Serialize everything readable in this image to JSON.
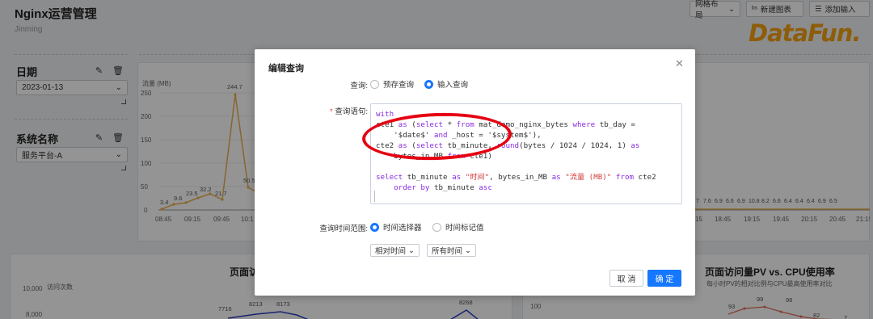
{
  "app": {
    "title": "Nginx运营管理",
    "subtitle": "Jinming"
  },
  "toolbar": {
    "grid_layout": "网格布局",
    "new_chart": "新建图表",
    "add_input": "添加输入",
    "grid_chevron_icon": "chevron-down",
    "new_chart_icon": "bar-chart",
    "add_input_icon": "list"
  },
  "logo": {
    "text": "DataFun."
  },
  "filters": [
    {
      "title": "日期",
      "value": "2023-01-13"
    },
    {
      "title": "系统名称",
      "value": "服务平台-A"
    }
  ],
  "traffic_chart": {
    "ylabel": "流量 (MB)",
    "y_ticks": [
      "250",
      "200",
      "150",
      "100",
      "50",
      "0"
    ],
    "x_ticks": [
      "08:45",
      "09:15",
      "09:45",
      "10:1"
    ],
    "data_labels": [
      "3.4",
      "9.6",
      "23.5",
      "32.2",
      "21.7",
      "244.7",
      "50.5"
    ],
    "right_x_ticks": [
      "15",
      "18:45",
      "19:15",
      "19:45",
      "20:15",
      "20:45",
      "21:15"
    ],
    "right_labels": [
      ".7",
      "7.6",
      "6.9",
      "6.6",
      "6.9",
      "10.8",
      "8.2",
      "6.6",
      "6.4",
      "6.4",
      "6.4",
      "6.9",
      "6.5"
    ],
    "line_color": "#e8b04f"
  },
  "pv_chart": {
    "title": "页面访",
    "ylabel": "访问次数",
    "y_ticks": [
      "10,000",
      "8,000"
    ],
    "data_labels": [
      "7716",
      "8213",
      "8173",
      "8268"
    ],
    "line_color": "#2c3fbf"
  },
  "pv_cpu_chart": {
    "title": "页面访问量PV vs. CPU使用率",
    "subtitle": "每小时PV的相对比例与CPU最高使用率对比",
    "y_tick": "100",
    "data_labels": [
      "93",
      "99",
      "98",
      "82",
      "7"
    ],
    "line_color": "#e36a57"
  },
  "modal": {
    "title": "编辑查询",
    "query_label": "查询:",
    "query_options": [
      "预存查询",
      "输入查询"
    ],
    "query_selected": 1,
    "sql_label": "查询语句:",
    "sql_lines": [
      [
        {
          "t": "with",
          "c": "kw"
        }
      ],
      [
        {
          "t": "cte1 ",
          "c": ""
        },
        {
          "t": "as",
          "c": "kw"
        },
        {
          "t": " (",
          "c": ""
        },
        {
          "t": "select",
          "c": "kw"
        },
        {
          "t": " * ",
          "c": ""
        },
        {
          "t": "from",
          "c": "kw"
        },
        {
          "t": " mat_demo_nginx_bytes ",
          "c": ""
        },
        {
          "t": "where",
          "c": "kw"
        },
        {
          "t": " tb_day =",
          "c": ""
        }
      ],
      [
        {
          "t": "    '$date$' ",
          "c": ""
        },
        {
          "t": "and",
          "c": "kw"
        },
        {
          "t": " _host = '$system$'),",
          "c": ""
        }
      ],
      [
        {
          "t": "cte2 ",
          "c": ""
        },
        {
          "t": "as",
          "c": "kw"
        },
        {
          "t": " (",
          "c": ""
        },
        {
          "t": "select",
          "c": "kw"
        },
        {
          "t": " tb_minute, ",
          "c": ""
        },
        {
          "t": "round",
          "c": "kw"
        },
        {
          "t": "(bytes / 1024 / 1024, 1) ",
          "c": ""
        },
        {
          "t": "as",
          "c": "kw"
        }
      ],
      [
        {
          "t": "    bytes_in_MB ",
          "c": ""
        },
        {
          "t": "from",
          "c": "kw"
        },
        {
          "t": " cte1)",
          "c": ""
        }
      ],
      [
        {
          "t": "",
          "c": ""
        }
      ],
      [
        {
          "t": "select",
          "c": "kw"
        },
        {
          "t": " tb_minute ",
          "c": ""
        },
        {
          "t": "as",
          "c": "kw"
        },
        {
          "t": " ",
          "c": ""
        },
        {
          "t": "\"时间\"",
          "c": "str"
        },
        {
          "t": ", bytes_in_MB ",
          "c": ""
        },
        {
          "t": "as",
          "c": "kw"
        },
        {
          "t": " ",
          "c": ""
        },
        {
          "t": "\"流量 (MB)\"",
          "c": "str"
        },
        {
          "t": " ",
          "c": ""
        },
        {
          "t": "from",
          "c": "kw"
        },
        {
          "t": " cte2",
          "c": ""
        }
      ],
      [
        {
          "t": "    ",
          "c": ""
        },
        {
          "t": "order by",
          "c": "kw"
        },
        {
          "t": " tb_minute ",
          "c": ""
        },
        {
          "t": "asc",
          "c": "kw"
        }
      ]
    ],
    "time_label": "查询时间范围:",
    "time_options": [
      "时间选择器",
      "时间标记值"
    ],
    "time_selected": 0,
    "relative_time": "相对时间",
    "all_time": "所有时间",
    "cancel": "取 消",
    "ok": "确 定",
    "annotation_color": "#e60012",
    "accent": "#1677ff"
  }
}
